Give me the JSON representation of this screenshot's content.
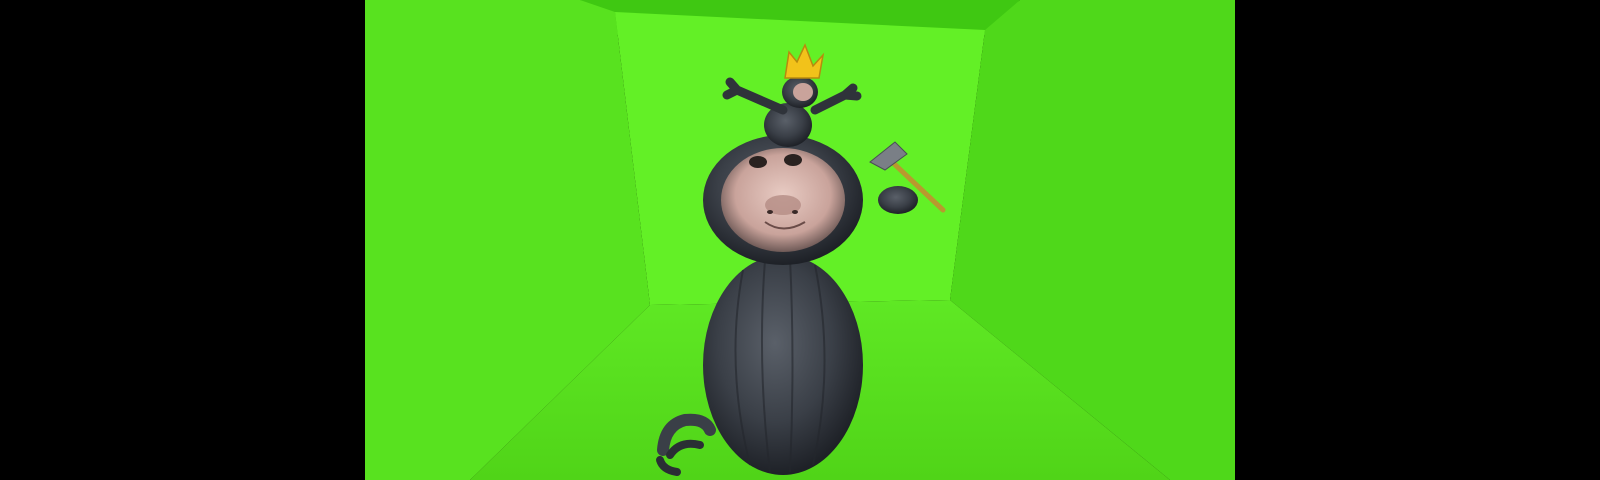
{
  "scene": {
    "room_colors": {
      "back_wall": "#63f026",
      "left_wall": "#55e21e",
      "right_wall": "#4fd81a",
      "ceiling": "#3fc812",
      "floor": "#58e01d"
    },
    "character": {
      "crown_color": "#f2c21a",
      "body_color": "#3a3f47",
      "face_color": "#d9b8b0"
    },
    "props": [
      "crown-icon",
      "hammer-icon",
      "bird-foot-icon"
    ]
  }
}
